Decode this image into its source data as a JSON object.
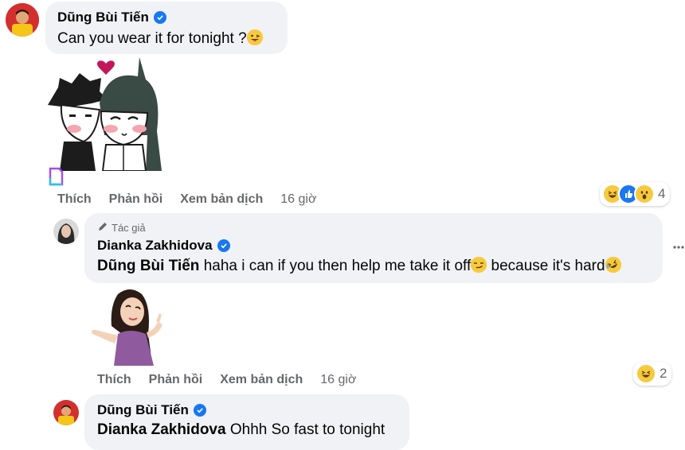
{
  "comment1": {
    "author": "Dũng Bùi Tiến",
    "text": "Can you wear it for tonight ?",
    "actions": {
      "like": "Thích",
      "reply": "Phản hồi",
      "translate": "Xem bản dịch",
      "time": "16 giờ"
    },
    "reaction_count": "4",
    "reactions": [
      "haha-icon",
      "like-icon",
      "wow-icon"
    ]
  },
  "reply1": {
    "badge": "Tác giả",
    "author": "Dianka Zakhidova",
    "mention": "Dũng Bùi Tiến",
    "text_part1": "haha i can if you then help me take it off",
    "text_part2": "because it's hard",
    "actions": {
      "like": "Thích",
      "reply": "Phản hồi",
      "translate": "Xem bản dịch",
      "time": "16 giờ"
    },
    "reaction_count": "2",
    "reactions": [
      "haha-icon"
    ]
  },
  "reply2": {
    "author": "Dũng Bùi Tiến",
    "mention": "Dianka Zakhidova",
    "text": "Ohhh So fast to tonight"
  },
  "colors": {
    "bubble": "#f0f2f5",
    "verified": "#1877f2",
    "secondary_text": "#65676b",
    "heart": "#c2185b"
  }
}
